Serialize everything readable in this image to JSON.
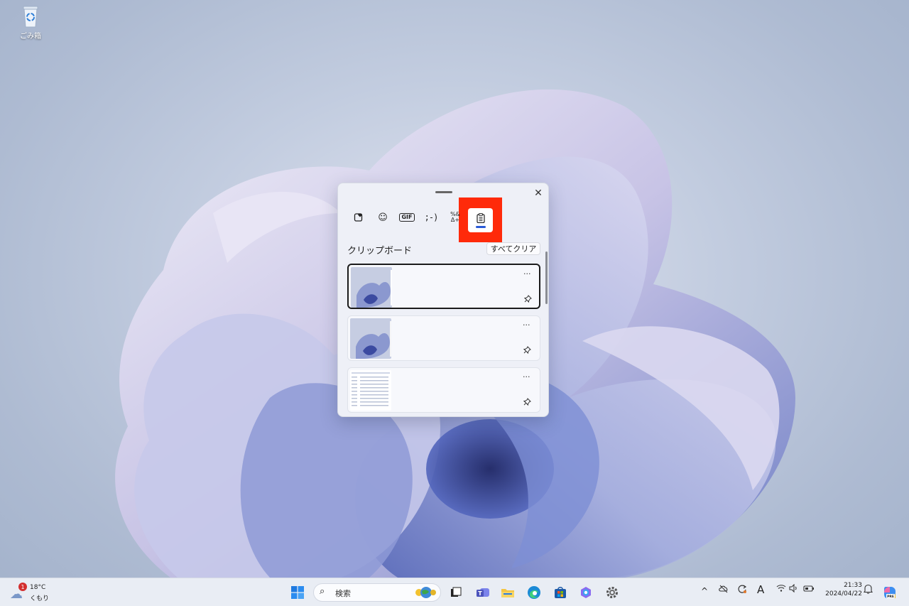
{
  "desktop": {
    "recycle_bin_label": "ごみ箱"
  },
  "panel": {
    "close_glyph": "✕",
    "tabs": [
      {
        "name": "favorites",
        "icon": "heart-sticker-icon"
      },
      {
        "name": "emoji",
        "glyph": "☺"
      },
      {
        "name": "gif",
        "glyph": "GIF"
      },
      {
        "name": "kaomoji",
        "glyph": ";-)"
      },
      {
        "name": "symbols",
        "glyph": "%&\nΔ+"
      },
      {
        "name": "clipboard",
        "icon": "clipboard-icon",
        "selected": true
      }
    ],
    "section_title": "クリップボード",
    "clear_all_label": "すべてクリア",
    "items": [
      {
        "type": "image",
        "more": "···",
        "pin": "📌",
        "selected": true
      },
      {
        "type": "image",
        "more": "···",
        "pin": "📌",
        "selected": false
      },
      {
        "type": "image",
        "more": "···",
        "pin": "📌",
        "selected": false
      }
    ],
    "highlight_color": "#ff2a0a"
  },
  "taskbar": {
    "weather": {
      "badge": "1",
      "temp": "18°C",
      "condition": "くもり"
    },
    "search_placeholder": "検索",
    "apps": [
      "start-icon",
      "task-view-icon",
      "teams-icon",
      "file-explorer-icon",
      "edge-icon",
      "store-icon",
      "copilot-icon",
      "settings-icon"
    ],
    "tray": {
      "chevron": "^",
      "ime": "A",
      "time": "21:33",
      "date": "2024/04/22"
    }
  }
}
